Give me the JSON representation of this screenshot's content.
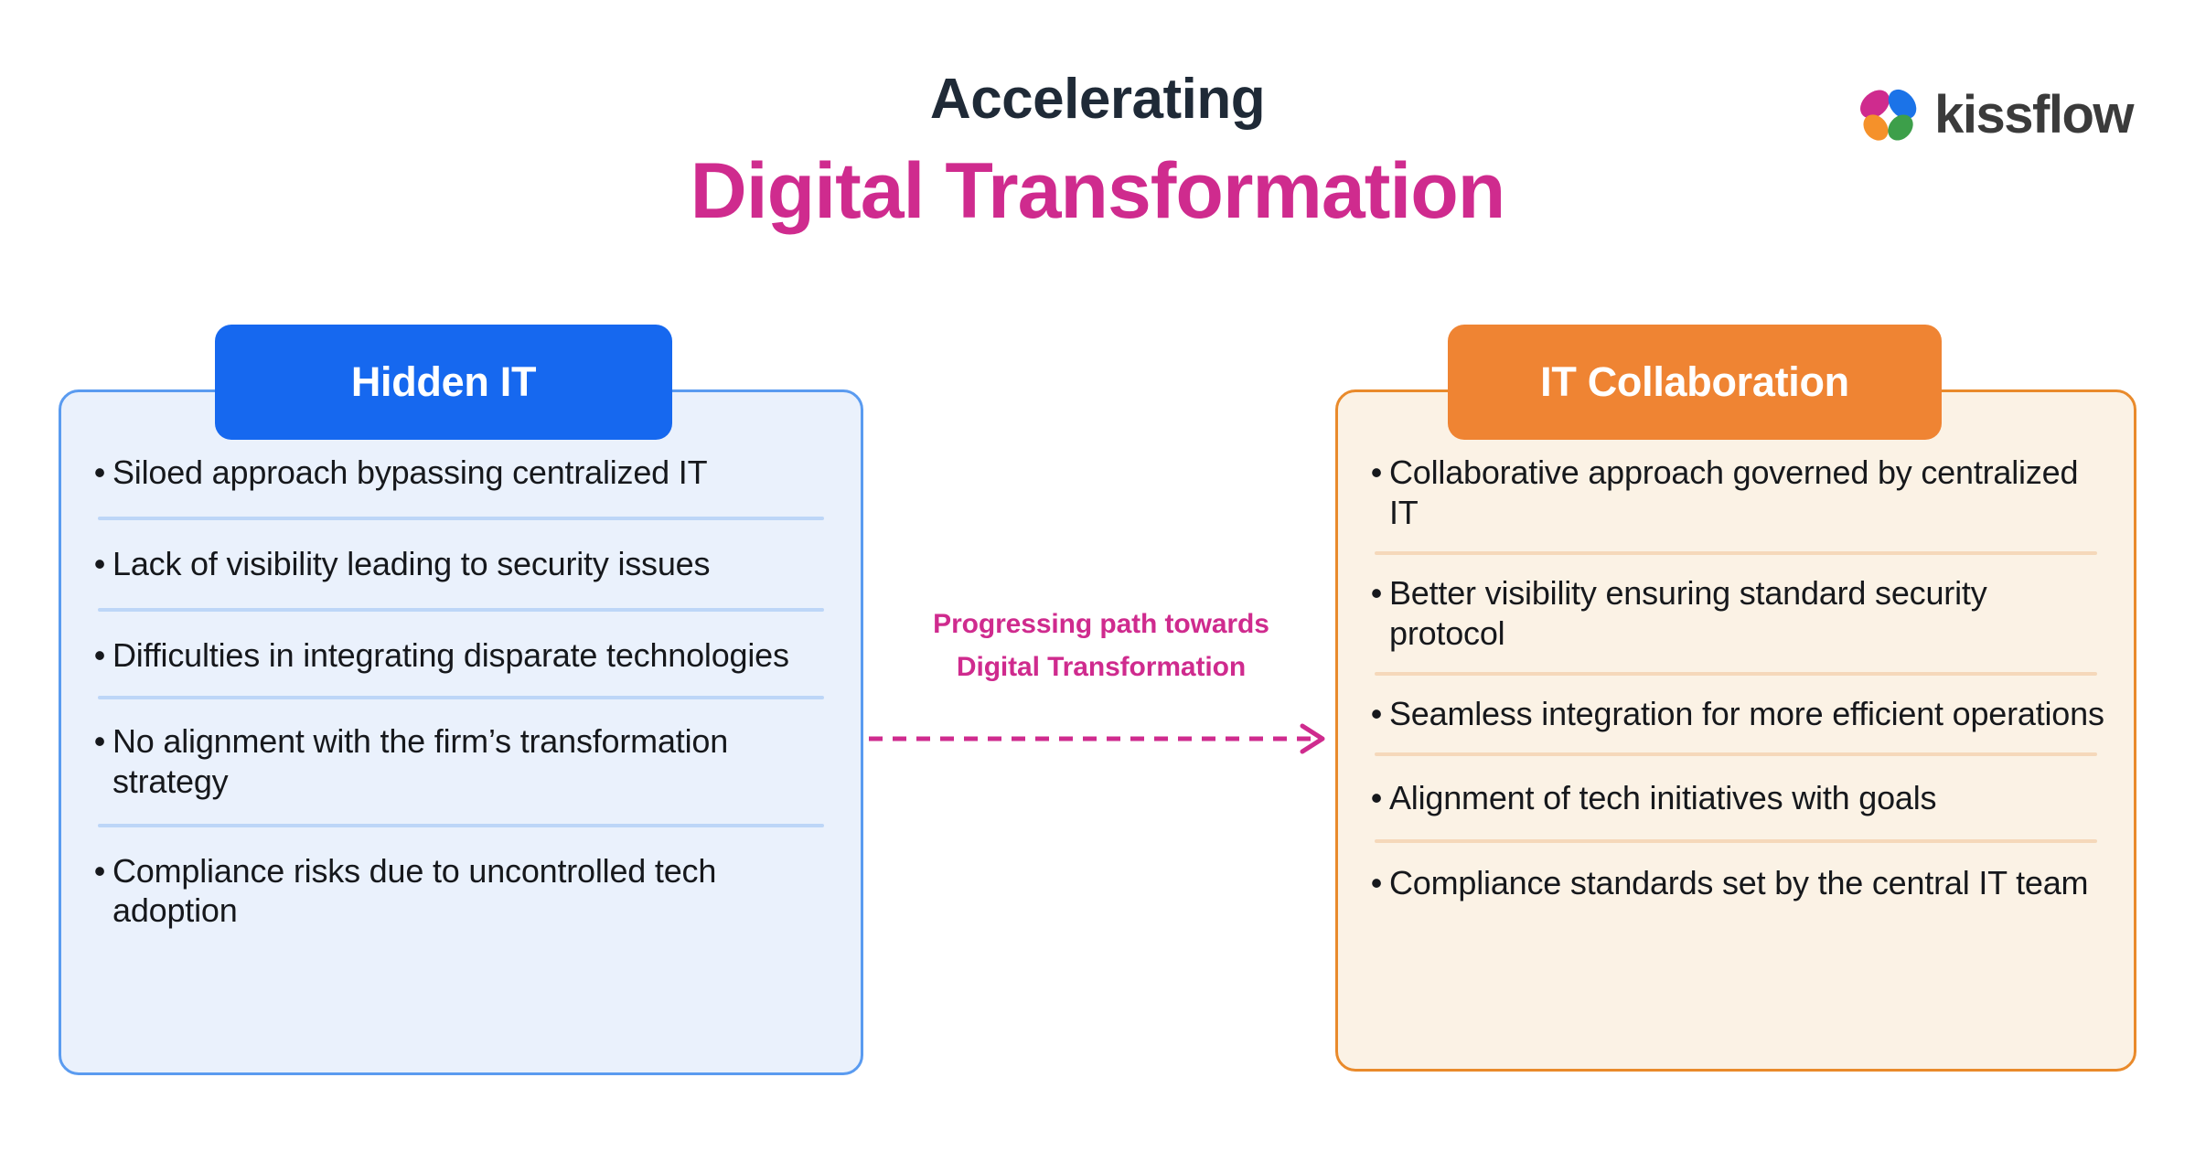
{
  "header": {
    "title_line1": "Accelerating",
    "title_line2": "Digital Transformation",
    "logo_text": "kissflow",
    "logo_mark_name": "kissflow-butterfly-mark",
    "title_color": "#1f2a37",
    "accent_color": "#cf2b8e"
  },
  "left_panel": {
    "heading": "Hidden IT",
    "heading_color": "#1668ef",
    "background_color": "#eaf1fc",
    "border_color": "#5a9bf0",
    "divider_color": "#bdd6f7",
    "bullet_glyph": "•",
    "items": [
      "Siloed approach bypassing centralized IT",
      "Lack of visibility leading to security issues",
      "Difficulties in integrating disparate technologies",
      "No alignment with the firm’s transformation strategy",
      "Compliance risks due to uncontrolled tech adoption"
    ]
  },
  "right_panel": {
    "heading": "IT Collaboration",
    "heading_color": "#ef8433",
    "background_color": "#fbf2e5",
    "border_color": "#e98a2b",
    "divider_color": "#f5d8ba",
    "bullet_glyph": "•",
    "items": [
      "Collaborative approach governed by centralized IT",
      "Better visibility ensuring standard security protocol",
      "Seamless integration for more efficient operations",
      "Alignment of tech initiatives with goals",
      "Compliance standards set by the central IT team"
    ]
  },
  "connector": {
    "label_line1": "Progressing path towards",
    "label_line2": "Digital Transformation",
    "color": "#cf2b8e",
    "style": "dashed-arrow-right"
  }
}
